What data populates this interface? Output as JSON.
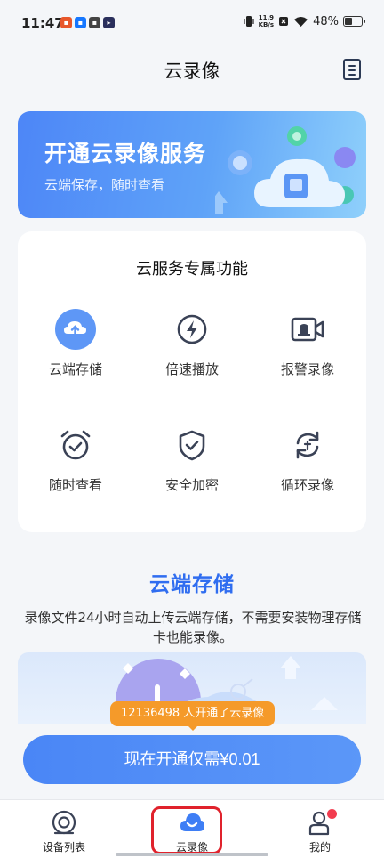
{
  "status_bar": {
    "time": "11:47",
    "network_speed_value": "11.9",
    "network_speed_unit": "KB/s",
    "battery": "48%",
    "battery_level": 0.48
  },
  "header": {
    "title": "云录像"
  },
  "banner": {
    "title": "开通云录像服务",
    "subtitle": "云端保存，随时查看"
  },
  "features": {
    "title": "云服务专属功能",
    "items": [
      {
        "label": "云端存储",
        "icon": "cloud-upload-icon"
      },
      {
        "label": "倍速播放",
        "icon": "lightning-icon"
      },
      {
        "label": "报警录像",
        "icon": "alarm-camera-icon"
      },
      {
        "label": "随时查看",
        "icon": "alarm-clock-icon"
      },
      {
        "label": "安全加密",
        "icon": "shield-check-icon"
      },
      {
        "label": "循环录像",
        "icon": "cycle-icon"
      }
    ]
  },
  "section": {
    "title": "云端存储",
    "description": "录像文件24小时自动上传云端存储，不需要安装物理存储卡也能录像。"
  },
  "promo": {
    "badge": "12136498 人开通了云录像",
    "cta": "现在开通仅需¥0.01"
  },
  "tabbar": {
    "items": [
      {
        "label": "设备列表",
        "icon": "device-list-icon"
      },
      {
        "label": "云录像",
        "icon": "cloud-recording-icon",
        "active": true
      },
      {
        "label": "我的",
        "icon": "profile-icon",
        "badge_dot": true
      }
    ]
  },
  "colors": {
    "accent": "#2f6df0",
    "cta": "#4a86f6",
    "badge": "#f59a2a",
    "notification": "#f23c4f"
  }
}
